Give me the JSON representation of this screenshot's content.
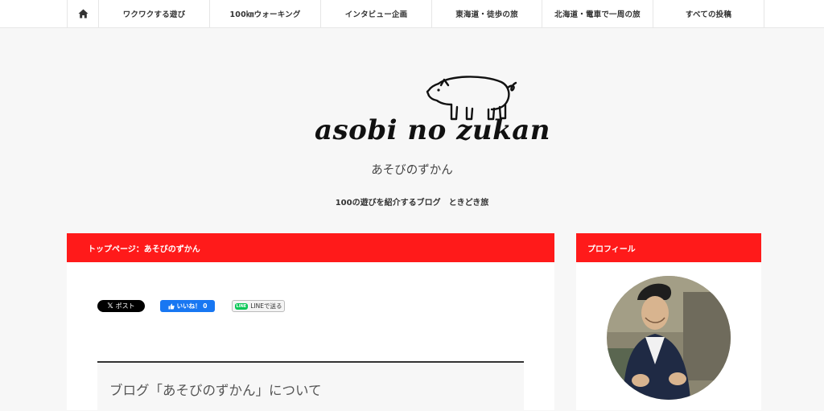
{
  "nav": {
    "items": [
      "ワクワクする遊び",
      "100㎞ウォーキング",
      "インタビュー企画",
      "東海道・徒歩の旅",
      "北海道・電車で一周の旅",
      "すべての投稿"
    ]
  },
  "header": {
    "logo_text": "asobi no zukan",
    "site_title_jp": "あそびのずかん",
    "tagline": "100の遊びを紹介するブログ　ときどき旅"
  },
  "main": {
    "breadcrumb": "トップページ：あそびのずかん",
    "share": {
      "x_label": "ポスト",
      "fb_label": "いいね！ 0",
      "line_label": "LINEで送る",
      "line_badge": "LINE"
    },
    "section_title": "ブログ「あそびのずかん」について"
  },
  "sidebar": {
    "profile_title": "プロフィール"
  },
  "colors": {
    "accent_red": "#ff1a1a",
    "fb_blue": "#1877f2",
    "line_green": "#06c755"
  }
}
